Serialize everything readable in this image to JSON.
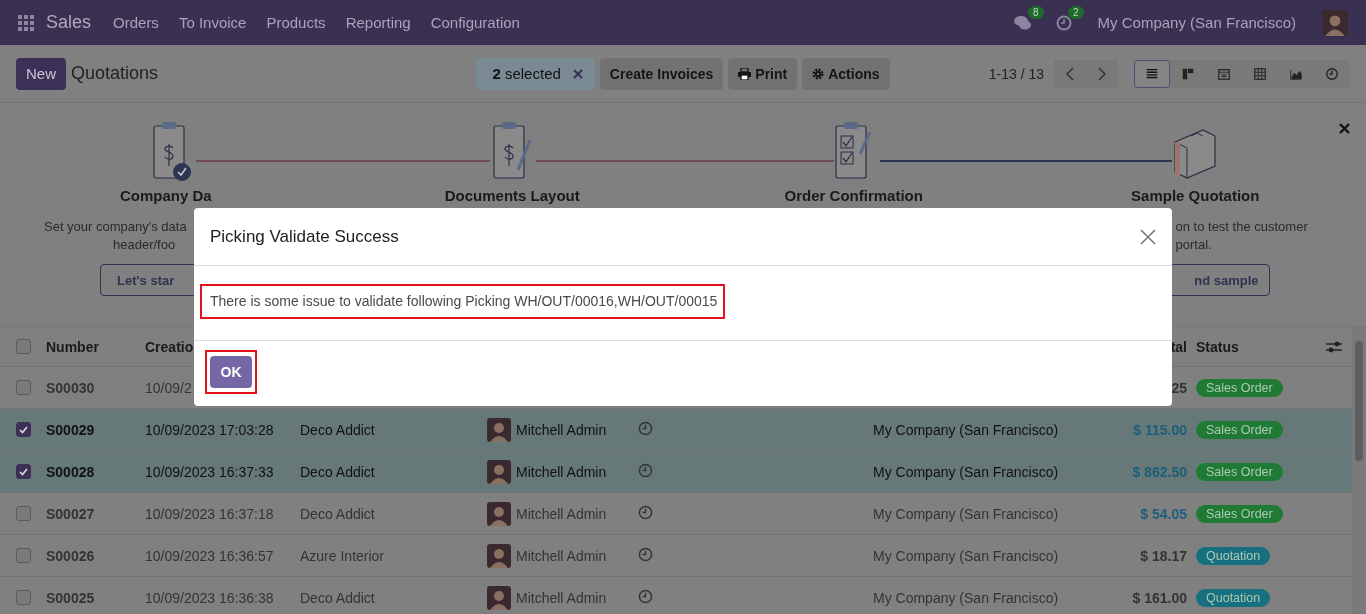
{
  "navbar": {
    "app": "Sales",
    "menu": [
      "Orders",
      "To Invoice",
      "Products",
      "Reporting",
      "Configuration"
    ],
    "messages_count": "8",
    "activities_count": "2",
    "company": "My Company (San Francisco)"
  },
  "control_panel": {
    "new_button": "New",
    "breadcrumb": "Quotations",
    "selection": "**2** selected",
    "actions": [
      {
        "label": "Create Invoices",
        "kind": "plain"
      },
      {
        "label": "Print",
        "kind": "print"
      },
      {
        "label": "Actions",
        "kind": "gear"
      }
    ],
    "pager": "1-13 / 13",
    "views": [
      {
        "kind": "list",
        "selected": true
      },
      {
        "kind": "kanban",
        "selected": false
      },
      {
        "kind": "calendar",
        "selected": false
      },
      {
        "kind": "pivot",
        "selected": false
      },
      {
        "kind": "graph",
        "selected": false
      },
      {
        "kind": "activity",
        "selected": false
      }
    ]
  },
  "onboarding": {
    "steps": [
      {
        "kind": "company",
        "title": "Company Da",
        "description": [
          "Set your company's data",
          "header/foo"
        ],
        "button": "Let's star",
        "done": true
      },
      {
        "kind": "layout",
        "title": "Documents Layout",
        "done": false
      },
      {
        "kind": "confirmation",
        "title": "Order Confirmation",
        "done": false
      },
      {
        "kind": "sample",
        "title": "Sample Quotation",
        "description": [
          "on to test the customer",
          "portal."
        ],
        "button": "nd sample",
        "done": false
      }
    ]
  },
  "table": {
    "all_selected": false,
    "header": {
      "number": "Number",
      "created": "Creatio",
      "total": "tal",
      "status": "Status"
    },
    "rows": [
      {
        "selected": false,
        "number": "S00030",
        "created": "10/09/2",
        "total": "25",
        "total_highlighted": false,
        "status": {
          "label": "Sales Order",
          "color": "#1f7a33"
        }
      },
      {
        "selected": true,
        "number": "S00029",
        "created": "10/09/2023 17:03:28",
        "customer": "Deco Addict",
        "salesperson": "Mitchell Admin",
        "company": "My Company (San Francisco)",
        "total": "$ 115.00",
        "total_highlighted": true,
        "status": {
          "label": "Sales Order",
          "color": "#1f7a33"
        }
      },
      {
        "selected": true,
        "number": "S00028",
        "created": "10/09/2023 16:37:33",
        "customer": "Deco Addict",
        "salesperson": "Mitchell Admin",
        "company": "My Company (San Francisco)",
        "total": "$ 862.50",
        "total_highlighted": true,
        "status": {
          "label": "Sales Order",
          "color": "#1f7a33"
        }
      },
      {
        "selected": false,
        "number": "S00027",
        "created": "10/09/2023 16:37:18",
        "customer": "Deco Addict",
        "salesperson": "Mitchell Admin",
        "company": "My Company (San Francisco)",
        "total": "$ 54.05",
        "total_highlighted": true,
        "status": {
          "label": "Sales Order",
          "color": "#1f7a33"
        }
      },
      {
        "selected": false,
        "number": "S00026",
        "created": "10/09/2023 16:36:57",
        "customer": "Azure Interior",
        "salesperson": "Mitchell Admin",
        "company": "My Company (San Francisco)",
        "total": "$ 18.17",
        "total_highlighted": false,
        "status": {
          "label": "Quotation",
          "color": "#17707f"
        }
      },
      {
        "selected": false,
        "number": "S00025",
        "created": "10/09/2023 16:36:38",
        "customer": "Deco Addict",
        "salesperson": "Mitchell Admin",
        "company": "My Company (San Francisco)",
        "total": "$ 161.00",
        "total_highlighted": false,
        "status": {
          "label": "Quotation",
          "color": "#17707f"
        }
      }
    ]
  },
  "dialog": {
    "title": "Picking Validate Success",
    "message": "There is some issue to validate following Picking WH/OUT/00016,WH/OUT/00015",
    "ok_button": "OK"
  }
}
